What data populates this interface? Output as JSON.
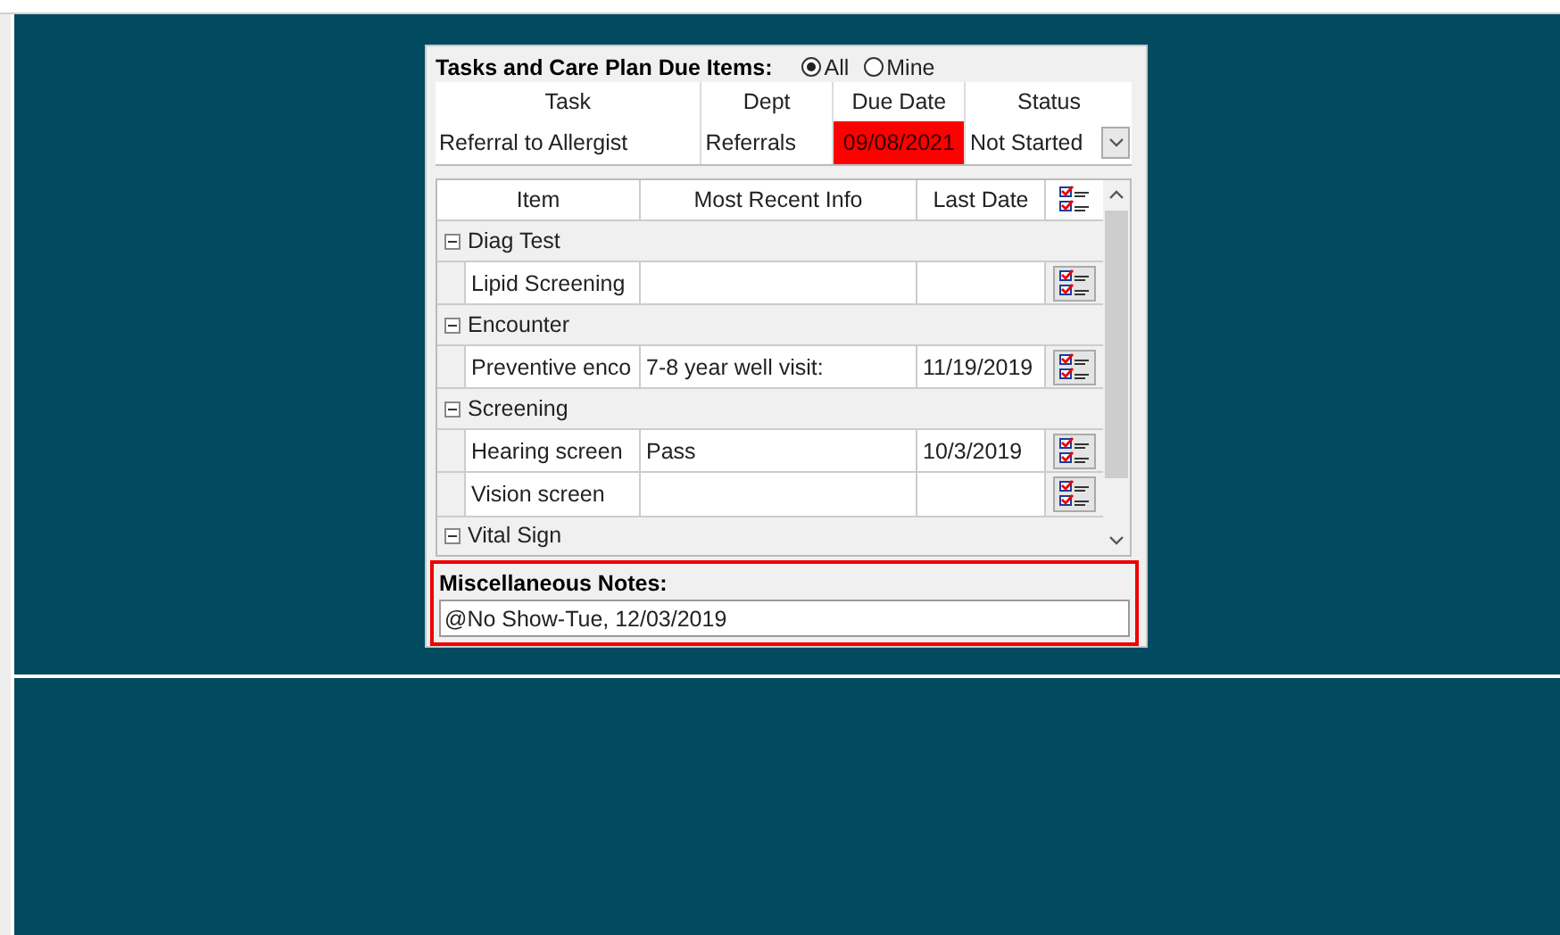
{
  "panel": {
    "title": "Tasks and Care Plan Due Items:",
    "filters": [
      {
        "label": "All",
        "selected": true
      },
      {
        "label": "Mine",
        "selected": false
      }
    ],
    "tasks": {
      "columns": [
        "Task",
        "Dept",
        "Due Date",
        "Status"
      ],
      "rows": [
        {
          "task": "Referral to Allergist",
          "dept": "Referrals",
          "due_date": "09/08/2021",
          "overdue": true,
          "status": "Not Started"
        }
      ]
    },
    "grid": {
      "columns": [
        "Item",
        "Most Recent Info",
        "Last Date"
      ],
      "groups": [
        {
          "name": "Diag Test",
          "expanded": true,
          "items": [
            {
              "item": "Lipid Screening"
            }
          ]
        },
        {
          "name": "Encounter",
          "expanded": true,
          "items": [
            {
              "item": "Preventive enco",
              "info": "7-8 year well visit:",
              "last_date": "11/19/2019"
            }
          ]
        },
        {
          "name": "Screening",
          "expanded": true,
          "items": [
            {
              "item": "Hearing screen",
              "info": "Pass",
              "last_date": "10/3/2019"
            },
            {
              "item": "Vision screen"
            }
          ]
        },
        {
          "name": "Vital Sign",
          "expanded": true
        }
      ]
    },
    "notes": {
      "label": "Miscellaneous Notes:",
      "value": "@No Show-Tue, 12/03/2019"
    }
  }
}
